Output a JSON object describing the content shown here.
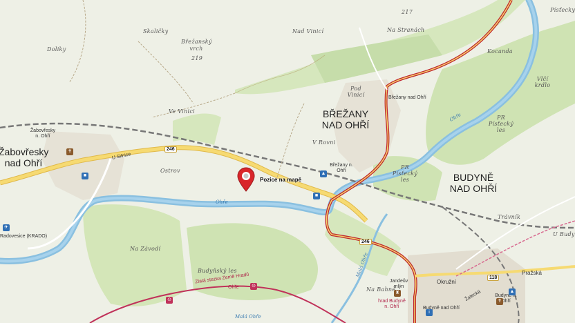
{
  "marker": {
    "label": "Pozice na mapě"
  },
  "towns": {
    "zabovresky": "Žabovřesky nad Ohří",
    "zabovresky_small": "Žabovřesky n. Ohří",
    "brezany": "BŘEŽANY NAD OHŘÍ",
    "brezany_small": "Břežany n. Ohří",
    "brezany_small2": "Břežany nad Ohří",
    "budyne": "BUDYNĚ NAD OHŘÍ",
    "budyne_small": "Budyně n. Ohří",
    "budyne_small2": "Budyně nad Ohří",
    "radovesice": "Radovesice (KRADO)"
  },
  "localities": {
    "skalicky": "Skaličky",
    "brezansky_vrch": "Břežanský vrch",
    "brezansky_vrch_alt": "219",
    "nad_vinici": "Nad Vinicí",
    "na_stranach": "Na Stranách",
    "peak_217": "217",
    "doliky": "Doliky",
    "ve_vinici": "Ve Vinici",
    "pod_vinici": "Pod Vinicí",
    "v_rovni": "V Rovni",
    "ostrov": "Ostrov",
    "na_zavodi": "Na Závodí",
    "budynsky_les": "Budyňský les",
    "na_bahne": "Na Bahně",
    "kocanda": "Kocanda",
    "vlci_krdlo": "Vlčí krdlo",
    "pr_pistecky_les": "PR Písťecký les",
    "pr_pistecky_les2": "PR Písťecký les",
    "travnik": "Trávník",
    "pistecky": "Písťecky",
    "u_budyne": "U Budyně",
    "jandeuv_mlyn": "Jandeův mlýn",
    "hrad_budyne": "hrad Budyně n. Ohří"
  },
  "streets": {
    "u_silnice": "U Silnice",
    "okruzni": "Okružní",
    "prazska": "Pražská",
    "zatecka": "Žatecká"
  },
  "roads": {
    "r246a": "246",
    "r246b": "246",
    "r118": "118"
  },
  "rivers": {
    "ohre_main": "Ohře",
    "ohre_upper": "Ohře",
    "mala_ohre": "Malá Ohře",
    "mala_ohre2": "Malá Ohře"
  },
  "trails": {
    "zlata_stezka": "Zlatá stezka Země Hradů",
    "ohre_trail": "Ohře"
  },
  "colors": {
    "background": "#eef0e6",
    "forest": "#cfe3b3",
    "river": "#7fb8dc",
    "road_main": "#f3d46a",
    "road_red": "#c0252f",
    "marker": "#d9262a",
    "railway": "#777777"
  }
}
